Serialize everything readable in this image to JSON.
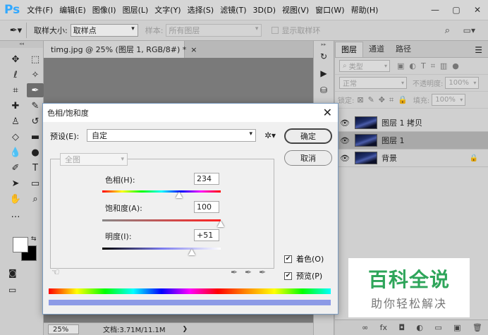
{
  "app": {
    "logo": "Ps",
    "menu": [
      "文件(F)",
      "编辑(E)",
      "图像(I)",
      "图层(L)",
      "文字(Y)",
      "选择(S)",
      "滤镜(T)",
      "3D(D)",
      "视图(V)",
      "窗口(W)",
      "帮助(H)"
    ],
    "window_controls": [
      "—",
      "▢",
      "✕"
    ]
  },
  "options": {
    "sample_size_label": "取样大小:",
    "sample_size_value": "取样点",
    "sample_label": "样本:",
    "sample_value": "所有图层",
    "ring_label": "显示取样环"
  },
  "document": {
    "tab_title": "timg.jpg @ 25% (图层 1, RGB/8#) *",
    "zoom": "25%",
    "doc_size": "文档:3.71M/11.1M",
    "more": "❯"
  },
  "layers_panel": {
    "tabs": [
      "图层",
      "通道",
      "路径"
    ],
    "filter_kind": "类型",
    "blend_mode": "正常",
    "opacity_label": "不透明度:",
    "opacity_value": "100%",
    "lock_label": "锁定:",
    "fill_label": "填充:",
    "fill_value": "100%",
    "layers": [
      {
        "name": "图层 1 拷贝",
        "selected": false,
        "locked": false
      },
      {
        "name": "图层 1",
        "selected": true,
        "locked": false
      },
      {
        "name": "背景",
        "selected": false,
        "locked": true
      }
    ],
    "footer_icons": [
      "∞",
      "fx",
      "◘",
      "◐",
      "▭",
      "▣",
      "🗑"
    ]
  },
  "dialog": {
    "title": "色相/饱和度",
    "close": "✕",
    "preset_label": "预设(E):",
    "preset_value": "自定",
    "channel_value": "全图",
    "ok_label": "确定",
    "cancel_label": "取消",
    "hue_label": "色相(H):",
    "hue_value": "234",
    "saturation_label": "饱和度(A):",
    "saturation_value": "100",
    "lightness_label": "明度(I):",
    "lightness_value": "+51",
    "colorize_label": "着色(O)",
    "colorize_checked": true,
    "preview_label": "预览(P)",
    "preview_checked": true,
    "hue_slider": {
      "min": 0,
      "max": 360,
      "value": 234
    },
    "saturation_slider": {
      "min": 0,
      "max": 100,
      "value": 100
    },
    "lightness_slider": {
      "min": -100,
      "max": 100,
      "value": 51
    }
  },
  "watermark": {
    "main": "百科全说",
    "sub": "助你轻松解决"
  }
}
